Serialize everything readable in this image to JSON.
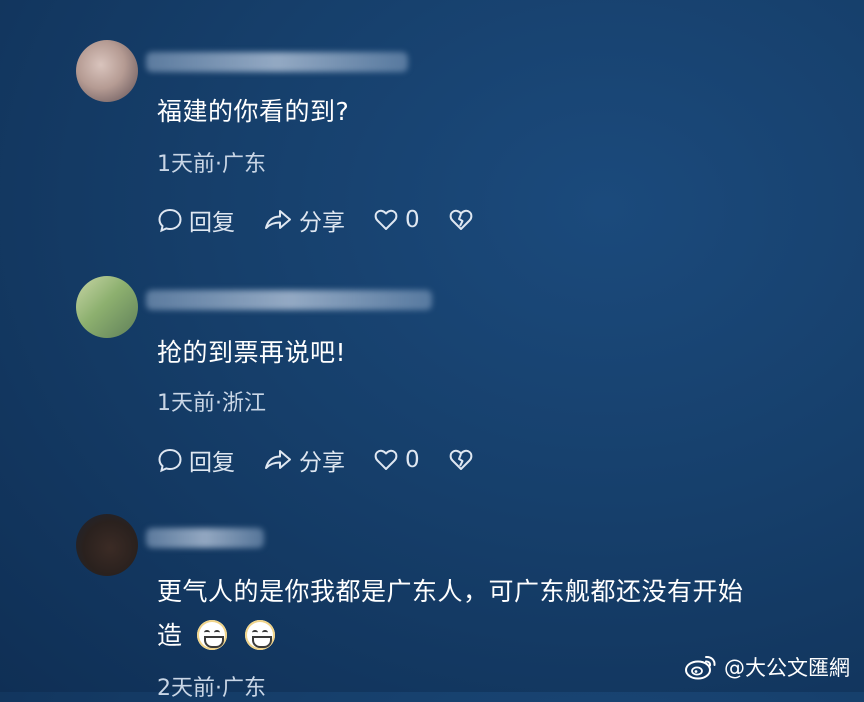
{
  "comments": [
    {
      "text": "福建的你看的到?",
      "meta": "1天前·广东",
      "reply_label": "回复",
      "share_label": "分享",
      "like_count": "0"
    },
    {
      "text": "抢的到票再说吧!",
      "meta": "1天前·浙江",
      "reply_label": "回复",
      "share_label": "分享",
      "like_count": "0"
    },
    {
      "text_line1": "更气人的是你我都是广东人，可广东舰都还没有开始",
      "text_line2": "造",
      "meta": "2天前·广东"
    }
  ],
  "watermark": "@大公文匯網"
}
